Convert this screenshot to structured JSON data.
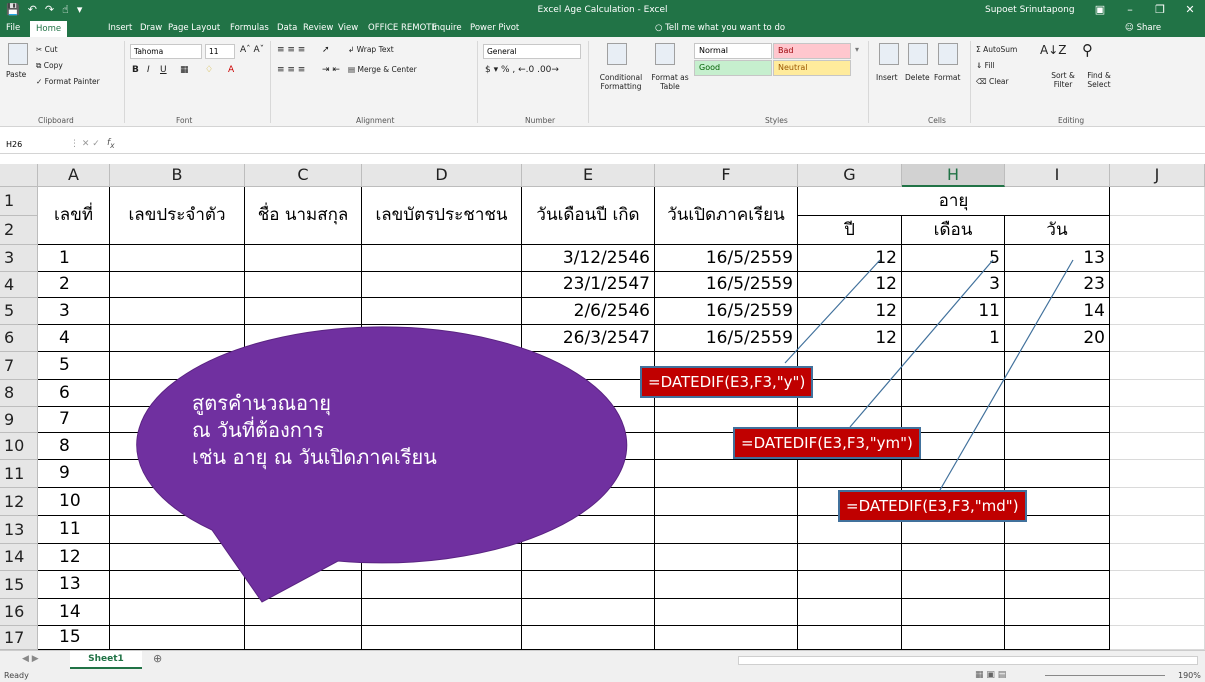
{
  "title_bar": {
    "title": "Excel Age Calculation - Excel",
    "user": "Supoet Srinutapong",
    "qat_icons": [
      "save-icon",
      "undo-icon",
      "redo-icon",
      "touch-mode-icon",
      "customize-icon"
    ]
  },
  "tabs": [
    "File",
    "Home",
    "Insert",
    "Draw",
    "Page Layout",
    "Formulas",
    "Data",
    "Review",
    "View",
    "OFFICE REMOTE",
    "Inquire",
    "Power Pivot"
  ],
  "active_tab": "Home",
  "tell_me": "Tell me what you want to do",
  "share": "Share",
  "ribbon": {
    "clipboard": {
      "label": "Clipboard",
      "paste": "Paste",
      "cut": "Cut",
      "copy": "Copy",
      "format_painter": "Format Painter"
    },
    "font": {
      "label": "Font",
      "name": "Tahoma",
      "size": "11"
    },
    "alignment": {
      "label": "Alignment",
      "wrap_text": "Wrap Text",
      "merge_center": "Merge & Center"
    },
    "number": {
      "label": "Number",
      "format": "General"
    },
    "styles": {
      "label": "Styles",
      "conditional": "Conditional Formatting",
      "format_as_table": "Format as Table",
      "normal": "Normal",
      "bad": "Bad",
      "good": "Good",
      "neutral": "Neutral"
    },
    "cells": {
      "label": "Cells",
      "insert": "Insert",
      "delete": "Delete",
      "format": "Format"
    },
    "editing": {
      "label": "Editing",
      "autosum": "AutoSum",
      "fill": "Fill",
      "clear": "Clear",
      "sort_filter": "Sort & Filter",
      "find_select": "Find & Select"
    }
  },
  "formula_bar": {
    "name_box": "H26",
    "formula": ""
  },
  "columns": [
    "A",
    "B",
    "C",
    "D",
    "E",
    "F",
    "G",
    "H",
    "I",
    "J"
  ],
  "selected_column": "H",
  "header_row": {
    "a": "เลขที่",
    "b": "เลขประจำตัว",
    "c": "ชื่อ นามสกุล",
    "d": "เลขบัตรประชาชน",
    "e": "วันเดือนปี เกิด",
    "f": "วันเปิดภาคเรียน",
    "age": "อายุ",
    "g": "ปี",
    "h": "เดือน",
    "i": "วัน"
  },
  "rows": [
    {
      "row": "3",
      "no": "1",
      "birth": "3/12/2546",
      "open": "16/5/2559",
      "y": "12",
      "m": "5",
      "d": "13"
    },
    {
      "row": "4",
      "no": "2",
      "birth": "23/1/2547",
      "open": "16/5/2559",
      "y": "12",
      "m": "3",
      "d": "23"
    },
    {
      "row": "5",
      "no": "3",
      "birth": "2/6/2546",
      "open": "16/5/2559",
      "y": "12",
      "m": "11",
      "d": "14"
    },
    {
      "row": "6",
      "no": "4",
      "birth": "26/3/2547",
      "open": "16/5/2559",
      "y": "12",
      "m": "1",
      "d": "20"
    },
    {
      "row": "7",
      "no": "5"
    },
    {
      "row": "8",
      "no": "6"
    },
    {
      "row": "9",
      "no": "7"
    },
    {
      "row": "10",
      "no": "8"
    },
    {
      "row": "11",
      "no": "9"
    },
    {
      "row": "12",
      "no": "10"
    },
    {
      "row": "13",
      "no": "11"
    },
    {
      "row": "14",
      "no": "12"
    },
    {
      "row": "15",
      "no": "13"
    },
    {
      "row": "16",
      "no": "14"
    },
    {
      "row": "17",
      "no": "15"
    }
  ],
  "row_numbers_top": [
    "1",
    "2"
  ],
  "callouts": {
    "years": "=DATEDIF(E3,F3,\"y\")",
    "months": "=DATEDIF(E3,F3,\"ym\")",
    "days": "=DATEDIF(E3,F3,\"md\")"
  },
  "bubble": {
    "line1": "สูตรคำนวณอายุ",
    "line2": "ณ วันที่ต้องการ",
    "line3": "เช่น อายุ ณ วันเปิดภาคเรียน",
    "color": "#7030a0"
  },
  "sheet_tab": "Sheet1",
  "status": {
    "ready": "Ready",
    "zoom": "190%"
  },
  "colors": {
    "excel_green": "#217346",
    "callout_red": "#c00000",
    "callout_border": "#41719c"
  }
}
